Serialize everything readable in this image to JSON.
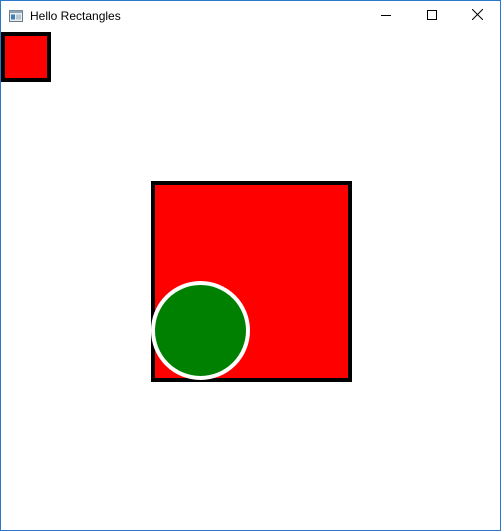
{
  "window": {
    "title": "Hello Rectangles",
    "border_color": "#2b78c9"
  },
  "titlebar": {
    "icon": "app-window-icon",
    "buttons": [
      {
        "name": "minimize-icon"
      },
      {
        "name": "maximize-icon"
      },
      {
        "name": "close-icon"
      }
    ]
  },
  "canvas": {
    "background": "#ffffff",
    "shapes": [
      {
        "kind": "rectangle",
        "fill": "#ff0000",
        "stroke": "#000000"
      },
      {
        "kind": "rectangle",
        "fill": "#ff0000",
        "stroke": "#000000"
      },
      {
        "kind": "circle",
        "fill": "#008000",
        "stroke": "#ffffff"
      }
    ]
  }
}
